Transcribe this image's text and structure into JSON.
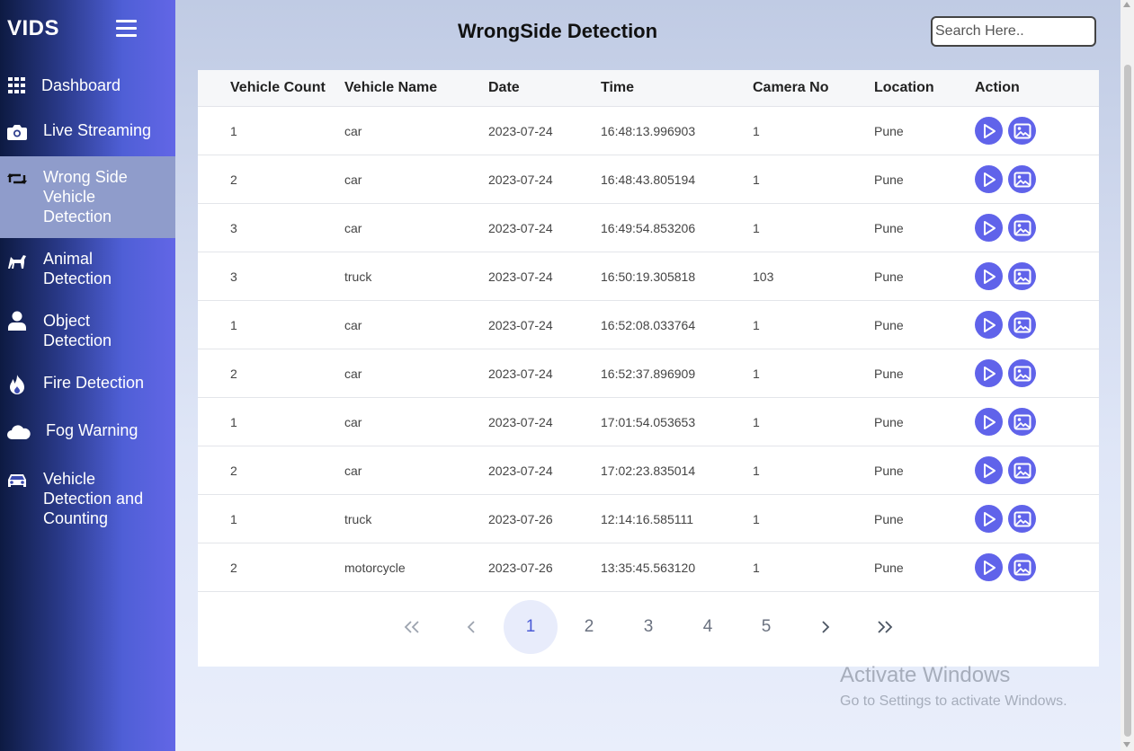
{
  "sidebar": {
    "brand": "VIDS",
    "items": [
      {
        "label": "Dashboard",
        "icon": "grid-icon"
      },
      {
        "label": "Live Streaming",
        "icon": "camera-icon"
      },
      {
        "label": "Wrong Side Vehicle Detection",
        "icon": "retweet-icon",
        "active": true
      },
      {
        "label": "Animal Detection",
        "icon": "horse-icon"
      },
      {
        "label": "Object Detection",
        "icon": "user-icon"
      },
      {
        "label": "Fire Detection",
        "icon": "fire-icon"
      },
      {
        "label": "Fog Warning",
        "icon": "cloud-icon"
      },
      {
        "label": "Vehicle Detection and Counting",
        "icon": "car-icon"
      }
    ]
  },
  "header": {
    "title": "WrongSide Detection",
    "search_placeholder": "Search Here.."
  },
  "table": {
    "columns": [
      "Vehicle Count",
      "Vehicle Name",
      "Date",
      "Time",
      "Camera No",
      "Location",
      "Action"
    ],
    "rows": [
      [
        "1",
        "car",
        "2023-07-24",
        "16:48:13.996903",
        "1",
        "Pune"
      ],
      [
        "2",
        "car",
        "2023-07-24",
        "16:48:43.805194",
        "1",
        "Pune"
      ],
      [
        "3",
        "car",
        "2023-07-24",
        "16:49:54.853206",
        "1",
        "Pune"
      ],
      [
        "3",
        "truck",
        "2023-07-24",
        "16:50:19.305818",
        "103",
        "Pune"
      ],
      [
        "1",
        "car",
        "2023-07-24",
        "16:52:08.033764",
        "1",
        "Pune"
      ],
      [
        "2",
        "car",
        "2023-07-24",
        "16:52:37.896909",
        "1",
        "Pune"
      ],
      [
        "1",
        "car",
        "2023-07-24",
        "17:01:54.053653",
        "1",
        "Pune"
      ],
      [
        "2",
        "car",
        "2023-07-24",
        "17:02:23.835014",
        "1",
        "Pune"
      ],
      [
        "1",
        "truck",
        "2023-07-26",
        "12:14:16.585111",
        "1",
        "Pune"
      ],
      [
        "2",
        "motorcycle",
        "2023-07-26",
        "13:35:45.563120",
        "1",
        "Pune"
      ]
    ],
    "row_actions": [
      "play-icon",
      "image-icon"
    ]
  },
  "pagination": {
    "first": "«",
    "prev": "‹",
    "pages": [
      "1",
      "2",
      "3",
      "4",
      "5"
    ],
    "current": "1",
    "next": "›",
    "last": "»"
  },
  "watermark": {
    "line1": "Activate Windows",
    "line2": "Go to Settings to activate Windows."
  },
  "colors": {
    "accent": "#6063ea",
    "active_nav": "#8f9ccb"
  }
}
